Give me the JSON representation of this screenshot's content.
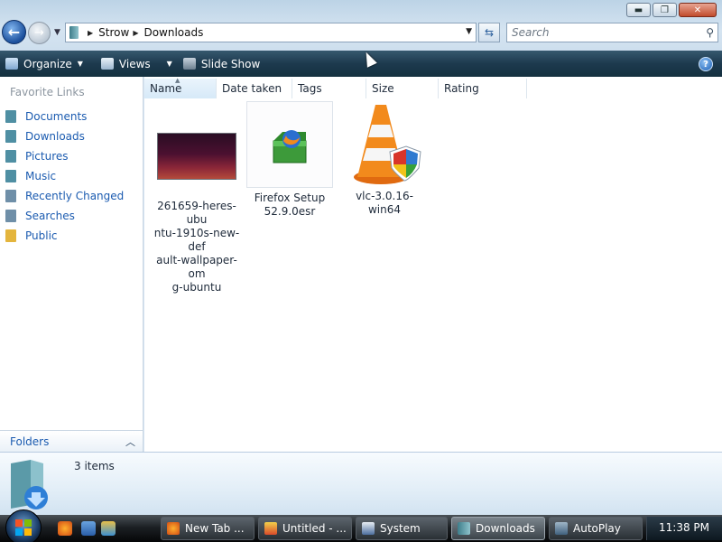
{
  "window": {
    "controls": {
      "minimize": "▬",
      "maximize": "❐",
      "close": "✕"
    }
  },
  "navigation": {
    "back": "←",
    "forward": "→",
    "breadcrumb": [
      "Strow",
      "Downloads"
    ],
    "search_placeholder": "Search"
  },
  "toolbar": {
    "items": [
      {
        "label": "Organize",
        "has_menu": true
      },
      {
        "label": "Views",
        "has_menu": true
      },
      {
        "label": "Slide Show",
        "has_menu": false
      }
    ],
    "help": "?"
  },
  "sidebar": {
    "title": "Favorite Links",
    "items": [
      {
        "label": "Documents",
        "icon": "documents-icon",
        "color": "#4f8fa3"
      },
      {
        "label": "Downloads",
        "icon": "downloads-icon",
        "color": "#4f8fa3"
      },
      {
        "label": "Pictures",
        "icon": "pictures-icon",
        "color": "#4f8fa3"
      },
      {
        "label": "Music",
        "icon": "music-icon",
        "color": "#4f8fa3"
      },
      {
        "label": "Recently Changed",
        "icon": "recently-changed-icon",
        "color": "#6f8fa8"
      },
      {
        "label": "Searches",
        "icon": "searches-icon",
        "color": "#6f8fa8"
      },
      {
        "label": "Public",
        "icon": "public-icon",
        "color": "#e4b53d"
      }
    ],
    "folders_label": "Folders"
  },
  "columns": [
    "Name",
    "Date taken",
    "Tags",
    "Size",
    "Rating"
  ],
  "files": [
    {
      "name": "261659-heres-ubuntu-1910s-new-default-wallpaper-omg-ubuntu",
      "lines": [
        "261659-heres-ubu",
        "ntu-1910s-new-def",
        "ault-wallpaper-om",
        "g-ubuntu"
      ],
      "icon": "image-thumbnail-icon"
    },
    {
      "name": "Firefox Setup 52.9.0esr",
      "lines": [
        "Firefox Setup",
        "52.9.0esr"
      ],
      "icon": "installer-package-icon"
    },
    {
      "name": "vlc-3.0.16-win64",
      "lines": [
        "vlc-3.0.16-win64"
      ],
      "icon": "vlc-cone-icon"
    }
  ],
  "details": {
    "count": "3 items"
  },
  "taskbar": {
    "tasks": [
      {
        "label": "New Tab ...",
        "icon": "firefox-icon"
      },
      {
        "label": "Untitled - ...",
        "icon": "paint-icon"
      },
      {
        "label": "System",
        "icon": "system-icon"
      },
      {
        "label": "Downloads",
        "icon": "folder-icon",
        "active": true
      },
      {
        "label": "AutoPlay",
        "icon": "autoplay-icon"
      }
    ],
    "clock": "11:38 PM"
  }
}
